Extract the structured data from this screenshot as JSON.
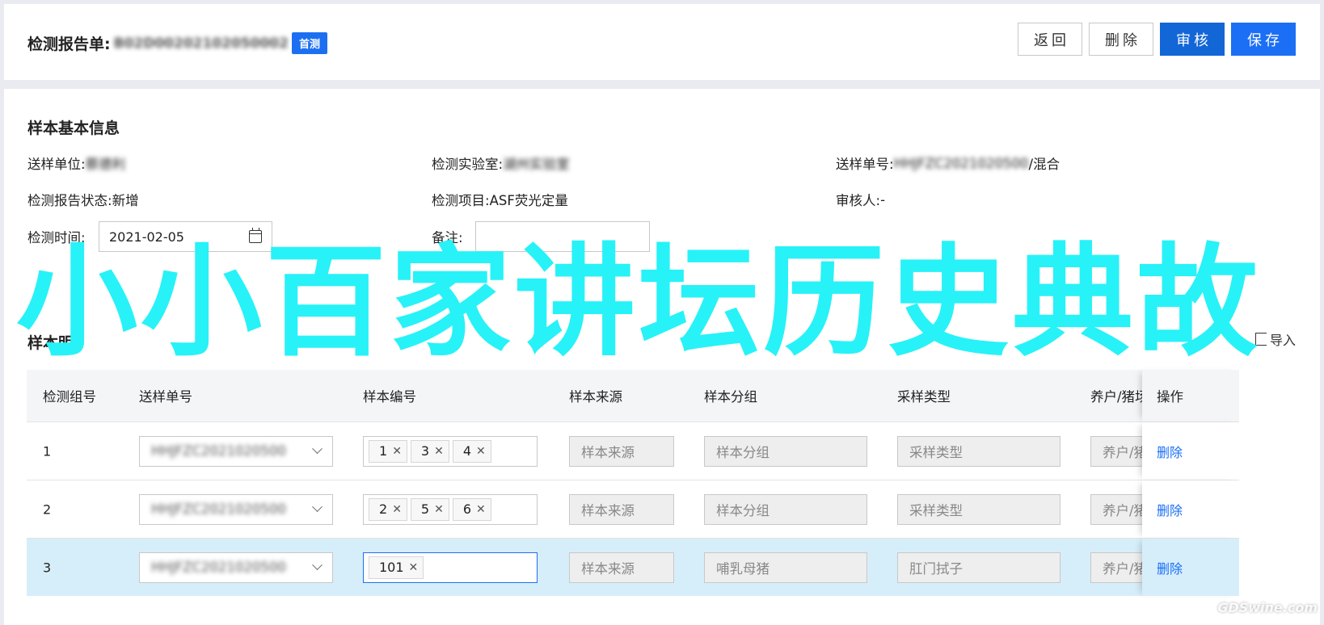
{
  "header": {
    "title_label": "检测报告单:",
    "report_id": "B02D00202102050002",
    "badge": "首测",
    "buttons": {
      "back": "返回",
      "delete": "删除",
      "audit": "审核",
      "save": "保存"
    }
  },
  "basic_info": {
    "section_title": "样本基本信息",
    "sender_unit_label": "送样单位:",
    "sender_unit_value": "蔡德利",
    "lab_label": "检测实验室:",
    "lab_value": "湖州实验室",
    "order_no_label": "送样单号:",
    "order_no_value": "HHJFZC2021020500",
    "order_no_suffix": "/混合",
    "status_label": "检测报告状态:",
    "status_value": "新增",
    "item_label": "检测项目:",
    "item_value": "ASF荧光定量",
    "auditor_label": "审核人:",
    "auditor_value": "-",
    "time_label": "检测时间:",
    "time_value": "2021-02-05",
    "note_label": "备注:"
  },
  "detail": {
    "section_title": "样本明",
    "import_label": "导入",
    "columns": [
      "检测组号",
      "送样单号",
      "样本编号",
      "样本来源",
      "样本分组",
      "采样类型",
      "养户/猪场",
      "操作"
    ],
    "placeholders": {
      "source": "样本来源",
      "group": "样本分组",
      "type": "采样类型",
      "farm": "养户/猪场"
    },
    "delete_label": "删除",
    "rows": [
      {
        "group_no": "1",
        "order_no": "HHJFZC2021020500",
        "samples": [
          "1",
          "3",
          "4"
        ],
        "group": "",
        "type": ""
      },
      {
        "group_no": "2",
        "order_no": "HHJFZC2021020500",
        "samples": [
          "2",
          "5",
          "6"
        ],
        "group": "",
        "type": ""
      },
      {
        "group_no": "3",
        "order_no": "HHJFZC2021020500",
        "samples": [
          "101"
        ],
        "group": "哺乳母猪",
        "type": "肛门拭子"
      }
    ]
  },
  "overlay_text": "小小百家讲坛历史典故",
  "watermark_text": "GDSwine.com",
  "colors": {
    "primary": "#1b6ff5",
    "overlay": "#27f2f7",
    "selected_row": "#d6eefa"
  }
}
